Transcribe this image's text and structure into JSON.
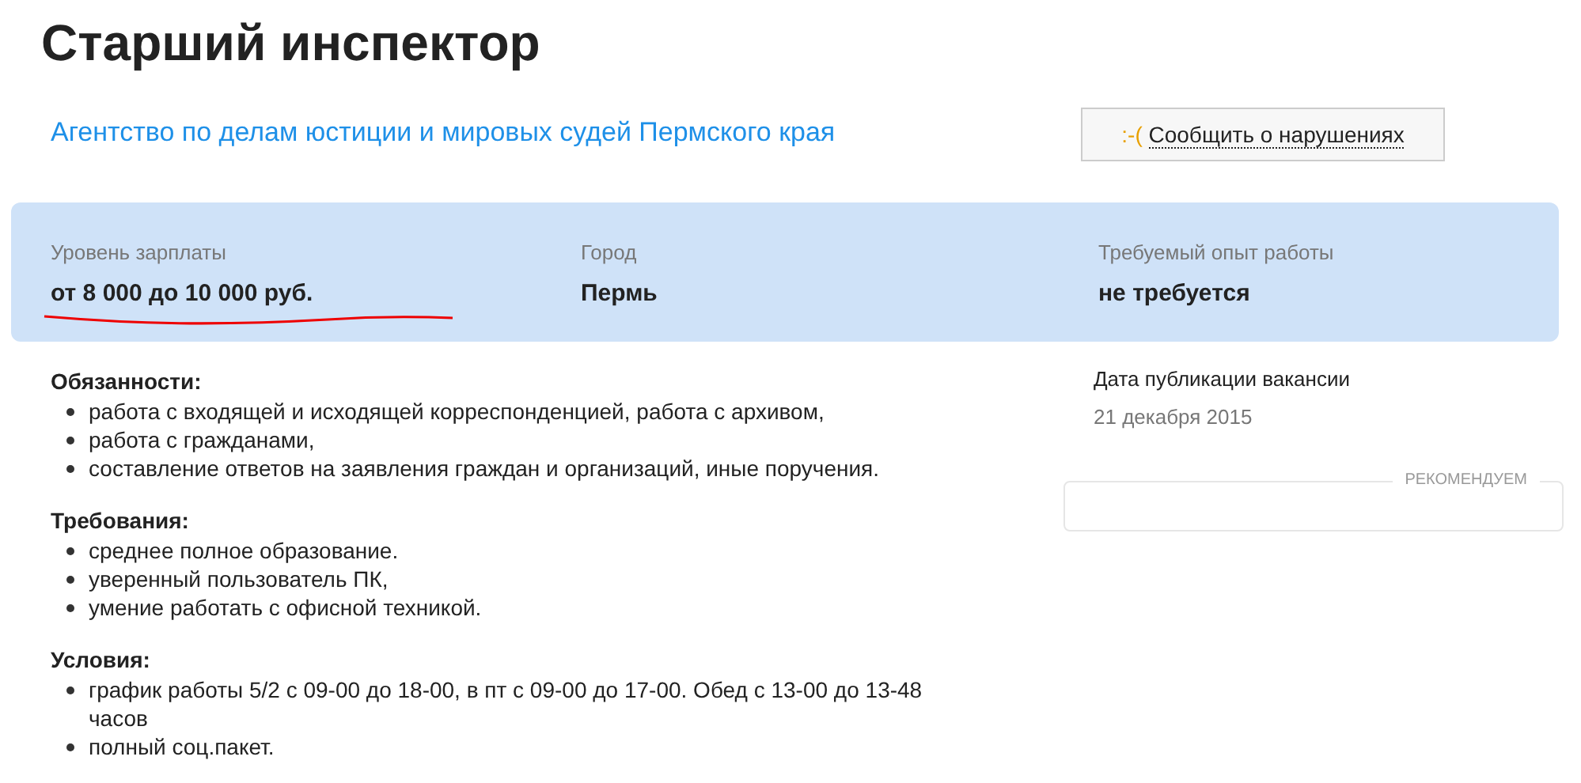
{
  "title": "Старший инспектор",
  "employer": {
    "name": "Агентство по делам юстиции и мировых судей Пермского края"
  },
  "report_button": {
    "icon": ":-(",
    "label": "Сообщить о нарушениях"
  },
  "summary": [
    {
      "label": "Уровень зарплаты",
      "value": "от 8 000 до 10 000 руб.",
      "underlined": true
    },
    {
      "label": "Город",
      "value": "Пермь",
      "underlined": false
    },
    {
      "label": "Требуемый опыт работы",
      "value": "не требуется",
      "underlined": false
    }
  ],
  "sections": [
    {
      "heading": "Обязанности:",
      "items": [
        "работа с входящей и исходящей корреспонденцией, работа с архивом,",
        "работа с гражданами,",
        "составление ответов на заявления граждан и организаций, иные поручения."
      ]
    },
    {
      "heading": "Требования:",
      "items": [
        "среднее полное образование.",
        "уверенный пользователь ПК,",
        "умение работать с офисной техникой."
      ]
    },
    {
      "heading": "Условия:",
      "items": [
        "график работы 5/2 с 09-00 до 18-00, в пт с 09-00 до 17-00. Обед с 13-00 до 13-48 часов",
        "полный соц.пакет."
      ]
    }
  ],
  "publication": {
    "label": "Дата публикации вакансии",
    "date": "21 декабря 2015"
  },
  "recommend": {
    "legend": "РЕКОМЕНДУЕМ"
  }
}
